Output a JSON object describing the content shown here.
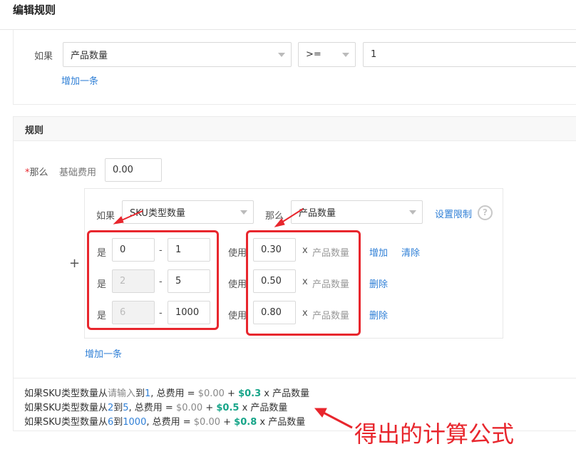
{
  "title": "编辑规则",
  "condition": {
    "label": "如果",
    "field": "产品数量",
    "operator": ">=",
    "value": "1",
    "add_link": "增加一条"
  },
  "rules": {
    "header": "规则",
    "required_mark": "*",
    "then_label": "那么",
    "base_fee_label": "基础费用",
    "base_fee_value": "0.00",
    "plus": "+",
    "if_label": "如果",
    "sku_select": "SKU类型数量",
    "then2_label": "那么",
    "product_select": "产品数量",
    "limit_link": "设置限制",
    "help": "?",
    "rows": [
      {
        "is": "是",
        "from": "0",
        "dash": "-",
        "to": "1",
        "use": "使用",
        "rate": "0.30",
        "x": "x",
        "unit": "产品数量",
        "actions": [
          "增加",
          "清除"
        ],
        "from_disabled": false
      },
      {
        "is": "是",
        "from": "2",
        "dash": "-",
        "to": "5",
        "use": "使用",
        "rate": "0.50",
        "x": "x",
        "unit": "产品数量",
        "actions": [
          "删除"
        ],
        "from_disabled": true
      },
      {
        "is": "是",
        "from": "6",
        "dash": "-",
        "to": "1000",
        "use": "使用",
        "rate": "0.80",
        "x": "x",
        "unit": "产品数量",
        "actions": [
          "删除"
        ],
        "from_disabled": true
      }
    ],
    "add_link": "增加一条"
  },
  "formulas": [
    {
      "p1": "如果SKU类型数量从",
      "a": "请输入",
      "p2": "到",
      "b": "1",
      "p3": ", 总费用 = ",
      "base": "$0.00",
      "p4": " + ",
      "rate": "$0.3",
      "p5": " x 产品数量"
    },
    {
      "p1": "如果SKU类型数量从",
      "a": "2",
      "p2": "到",
      "b": "5",
      "p3": ", 总费用 = ",
      "base": "$0.00",
      "p4": " + ",
      "rate": "$0.5",
      "p5": " x 产品数量"
    },
    {
      "p1": "如果SKU类型数量从",
      "a": "6",
      "p2": "到",
      "b": "1000",
      "p3": ", 总费用 = ",
      "base": "$0.00",
      "p4": " + ",
      "rate": "$0.8",
      "p5": " x 产品数量"
    }
  ],
  "annotation": "得出的计算公式",
  "colors": {
    "accent": "#2f7fd6",
    "highlight_green": "#17a589",
    "annotation_red": "#e8262d"
  }
}
